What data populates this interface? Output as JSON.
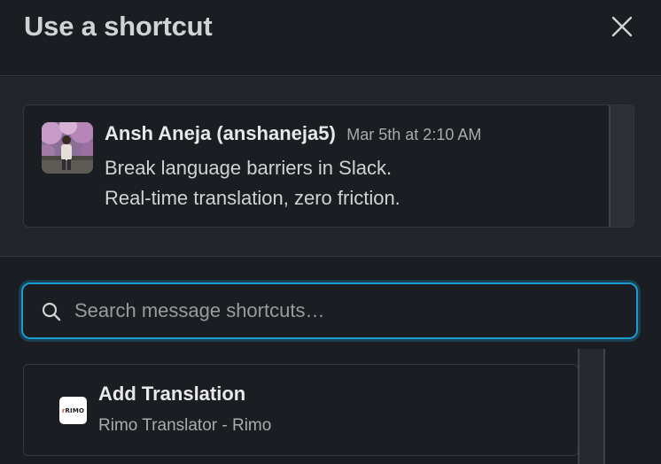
{
  "dialog": {
    "title": "Use a shortcut"
  },
  "message": {
    "author": "Ansh Aneja (anshaneja5)",
    "timestamp": "Mar 5th at 2:10 AM",
    "lines": [
      "Break language barriers in Slack.",
      "Real-time translation, zero friction."
    ]
  },
  "search": {
    "placeholder": "Search message shortcuts…",
    "value": ""
  },
  "shortcuts": [
    {
      "name": "Add Translation",
      "app": "Rimo Translator - Rimo",
      "icon_label": "RIMO"
    }
  ],
  "colors": {
    "background": "#1a1d21",
    "panel": "#222529",
    "focus_ring": "#1d9bd1"
  }
}
